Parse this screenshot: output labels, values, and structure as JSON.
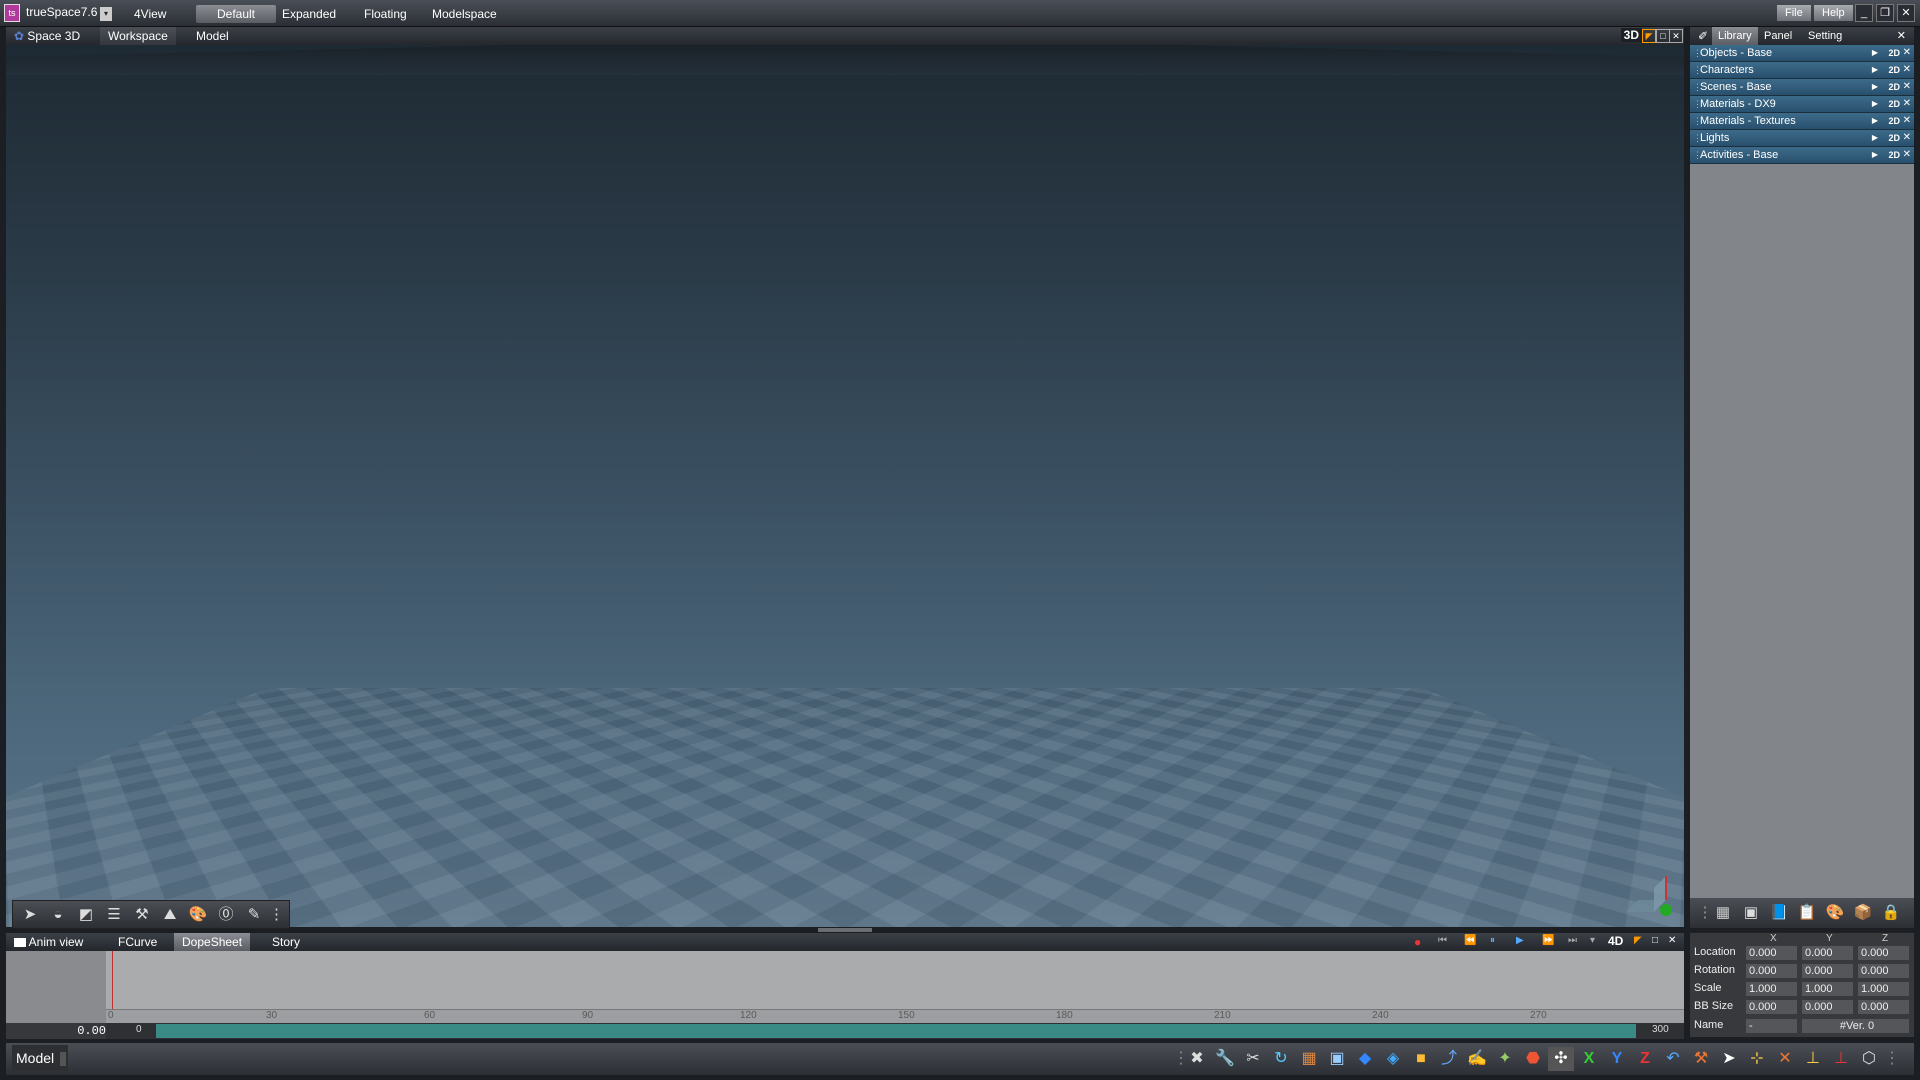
{
  "app": {
    "title": "trueSpace7.6",
    "layouts": [
      "4View",
      "Default",
      "Expanded",
      "Floating",
      "Modelspace"
    ],
    "active_layout": "Default",
    "menu": {
      "file": "File",
      "help": "Help"
    }
  },
  "viewport": {
    "space_label": "Space 3D",
    "tabs": [
      "Workspace",
      "Model"
    ],
    "active_tab": "Workspace",
    "badge": "3D"
  },
  "library": {
    "tabs": [
      "Library",
      "Panel",
      "Setting"
    ],
    "active_tab": "Library",
    "items": [
      "Objects - Base",
      "Characters",
      "Scenes - Base",
      "Materials - DX9",
      "Materials - Textures",
      "Lights",
      "Activities - Base"
    ],
    "badge_2d": "2D"
  },
  "anim": {
    "title": "Anim view",
    "tabs": [
      "FCurve",
      "DopeSheet",
      "Story"
    ],
    "active_tab": "DopeSheet",
    "badge": "4D",
    "time": "0.00",
    "ruler_ticks": [
      "0",
      "30",
      "60",
      "90",
      "120",
      "150",
      "180",
      "210",
      "240",
      "270"
    ],
    "range_start": "0",
    "range_end": "300"
  },
  "properties": {
    "columns": [
      "X",
      "Y",
      "Z"
    ],
    "rows": [
      {
        "label": "Location",
        "x": "0.000",
        "y": "0.000",
        "z": "0.000"
      },
      {
        "label": "Rotation",
        "x": "0.000",
        "y": "0.000",
        "z": "0.000"
      },
      {
        "label": "Scale",
        "x": "1.000",
        "y": "1.000",
        "z": "1.000"
      },
      {
        "label": "BB Size",
        "x": "0.000",
        "y": "0.000",
        "z": "0.000"
      }
    ],
    "name_label": "Name",
    "name_value": "-",
    "version": "#Ver. 0"
  },
  "status": {
    "mode": "Model"
  },
  "colors": {
    "range_bar": "#3a8a86",
    "library_row": "#3d6b8a",
    "playhead": "#c03030"
  }
}
